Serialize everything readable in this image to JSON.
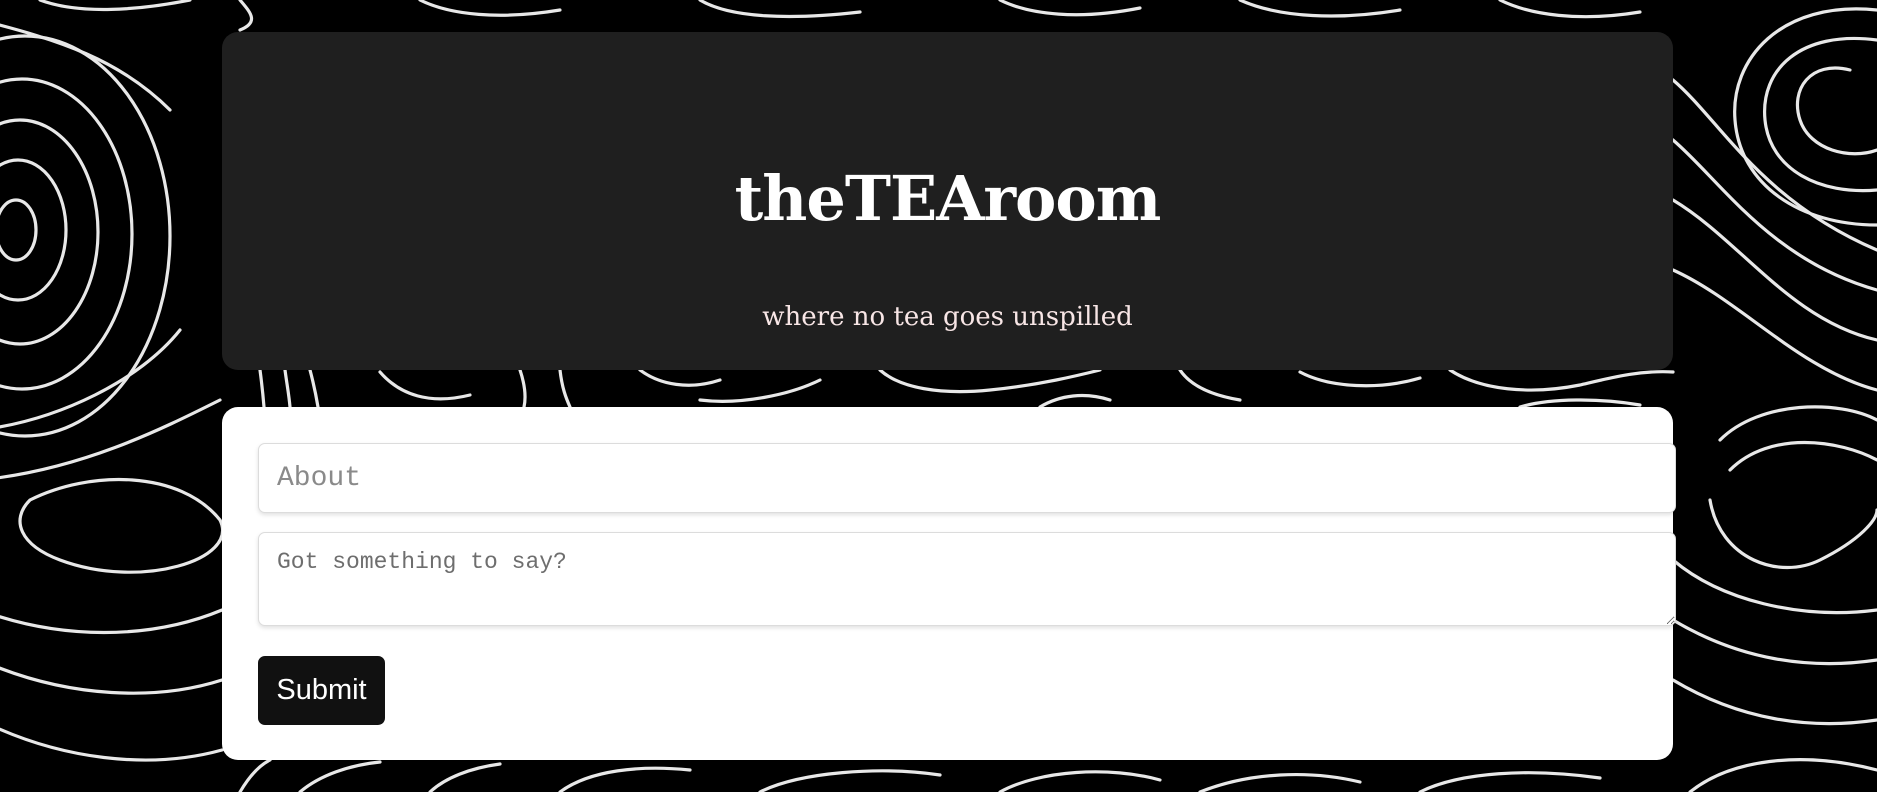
{
  "header": {
    "title": "theTEAroom",
    "tagline": "where no tea goes unspilled"
  },
  "form": {
    "about_placeholder": "About",
    "message_placeholder": "Got something to say?",
    "submit_label": "Submit"
  },
  "colors": {
    "page_background": "#000000",
    "contour_lines": "#ffffff",
    "header_card": "#1f1f1f",
    "form_card": "#ffffff",
    "button": "#111111"
  }
}
